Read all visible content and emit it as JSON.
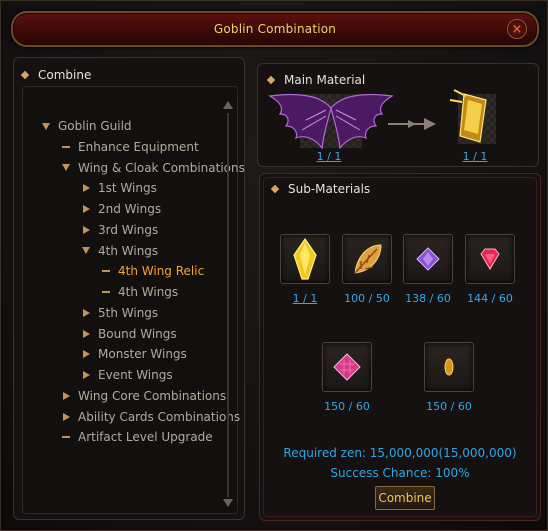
{
  "window": {
    "title": "Goblin Combination",
    "close_icon": "×"
  },
  "left": {
    "header": "Combine",
    "tree": [
      {
        "label": "Goblin Guild",
        "icon": "tri-down",
        "active": false
      },
      {
        "label": "Enhance Equipment",
        "icon": "dash",
        "active": false
      },
      {
        "label": "Wing & Cloak Combinations",
        "icon": "tri-down",
        "active": false
      },
      {
        "label": "1st Wings",
        "icon": "tri-right",
        "active": false
      },
      {
        "label": "2nd Wings",
        "icon": "tri-right",
        "active": false
      },
      {
        "label": "3rd Wings",
        "icon": "tri-right",
        "active": false
      },
      {
        "label": "4th Wings",
        "icon": "tri-down",
        "active": false
      },
      {
        "label": "4th Wing Relic",
        "icon": "dash",
        "active": true
      },
      {
        "label": "4th Wings",
        "icon": "dash",
        "active": false
      },
      {
        "label": "5th Wings",
        "icon": "tri-right",
        "active": false
      },
      {
        "label": "Bound Wings",
        "icon": "tri-right",
        "active": false
      },
      {
        "label": "Monster Wings",
        "icon": "tri-right",
        "active": false
      },
      {
        "label": "Event Wings",
        "icon": "tri-right",
        "active": false
      },
      {
        "label": "Wing Core Combinations",
        "icon": "tri-right",
        "active": false
      },
      {
        "label": "Ability Cards Combinations",
        "icon": "tri-right",
        "active": false
      },
      {
        "label": "Artifact Level Upgrade",
        "icon": "dash",
        "active": false
      }
    ]
  },
  "main_material": {
    "header": "Main Material",
    "left_item": {
      "name": "purple-wings-icon",
      "count": "1 / 1"
    },
    "right_item": {
      "name": "golden-relic-icon",
      "count": "1 / 1"
    }
  },
  "sub_materials": {
    "header": "Sub-Materials",
    "items": [
      {
        "name": "yellow-crystal-icon",
        "count": "1 / 1"
      },
      {
        "name": "feather-icon",
        "count": "100 / 50"
      },
      {
        "name": "purple-gem-icon",
        "count": "138 / 60"
      },
      {
        "name": "red-gem-icon",
        "count": "144 / 60"
      },
      {
        "name": "pink-gem-icon",
        "count": "150 / 60"
      },
      {
        "name": "gold-shard-icon",
        "count": "150 / 60"
      }
    ],
    "required_zen": "Required zen: 15,000,000(15,000,000)",
    "success_chance": "Success Chance: 100%",
    "combine_label": "Combine"
  },
  "colors": {
    "accent_gold": "#f2d36a",
    "active_orange": "#f0a23c",
    "info_blue": "#2fa6e6"
  }
}
